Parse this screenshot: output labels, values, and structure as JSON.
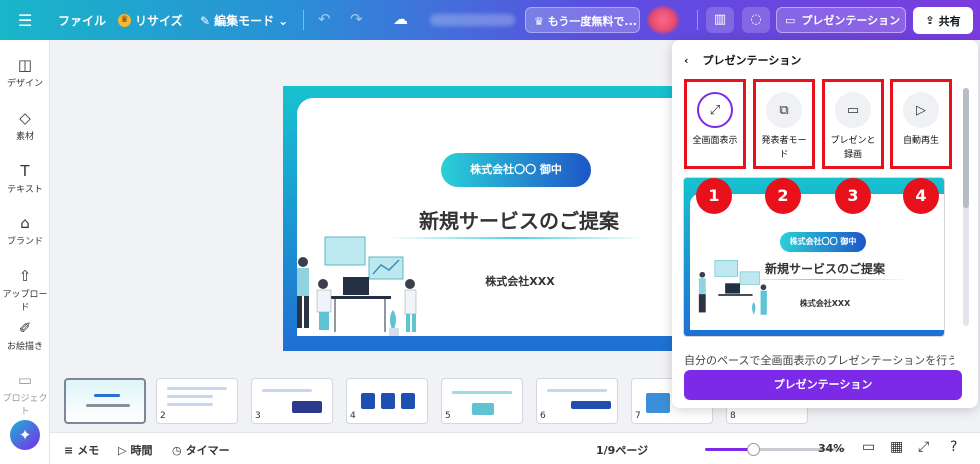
{
  "topbar": {
    "file": "ファイル",
    "resize": "リサイズ",
    "edit_mode": "編集モード",
    "trial": "もう一度無料で...",
    "present": "プレゼンテーション",
    "share": "共有"
  },
  "sidebar": {
    "items": [
      {
        "label": "デザイン",
        "icon": "design-icon"
      },
      {
        "label": "素材",
        "icon": "elements-icon"
      },
      {
        "label": "テキスト",
        "icon": "text-icon"
      },
      {
        "label": "ブランド",
        "icon": "brand-icon"
      },
      {
        "label": "アップロード",
        "icon": "upload-icon"
      },
      {
        "label": "お絵描き",
        "icon": "draw-icon"
      },
      {
        "label": "プロジェクト",
        "icon": "folder-icon"
      }
    ]
  },
  "slide": {
    "pill": "株式会社〇〇 御中",
    "title": "新規サービスのご提案",
    "company": "株式会社XXX"
  },
  "thumbs": [
    "",
    "2",
    "3",
    "4",
    "5",
    "6",
    "7",
    "8"
  ],
  "footer": {
    "memo": "メモ",
    "time": "時間",
    "timer": "タイマー",
    "page": "1/9ページ",
    "zoom": "34%",
    "zoom_level": 0.34
  },
  "panel": {
    "title": "プレゼンテーション",
    "options": [
      {
        "label": "全画面表示",
        "badge": "1"
      },
      {
        "label": "発表者モード",
        "badge": "2"
      },
      {
        "label": "プレゼンと録画",
        "badge": "3"
      },
      {
        "label": "自動再生",
        "badge": "4"
      }
    ],
    "preview": {
      "pill": "株式会社〇〇 御中",
      "title": "新規サービスのご提案",
      "company": "株式会社XXX"
    },
    "description": "自分のペースで全画面表示のプレゼンテーションを行うこ",
    "button": "プレゼンテーション"
  },
  "colors": {
    "accent": "#7d2ae8",
    "highlight": "#e8111b",
    "slide_grad_start": "#17c2cf",
    "slide_grad_end": "#1f6fd4"
  }
}
